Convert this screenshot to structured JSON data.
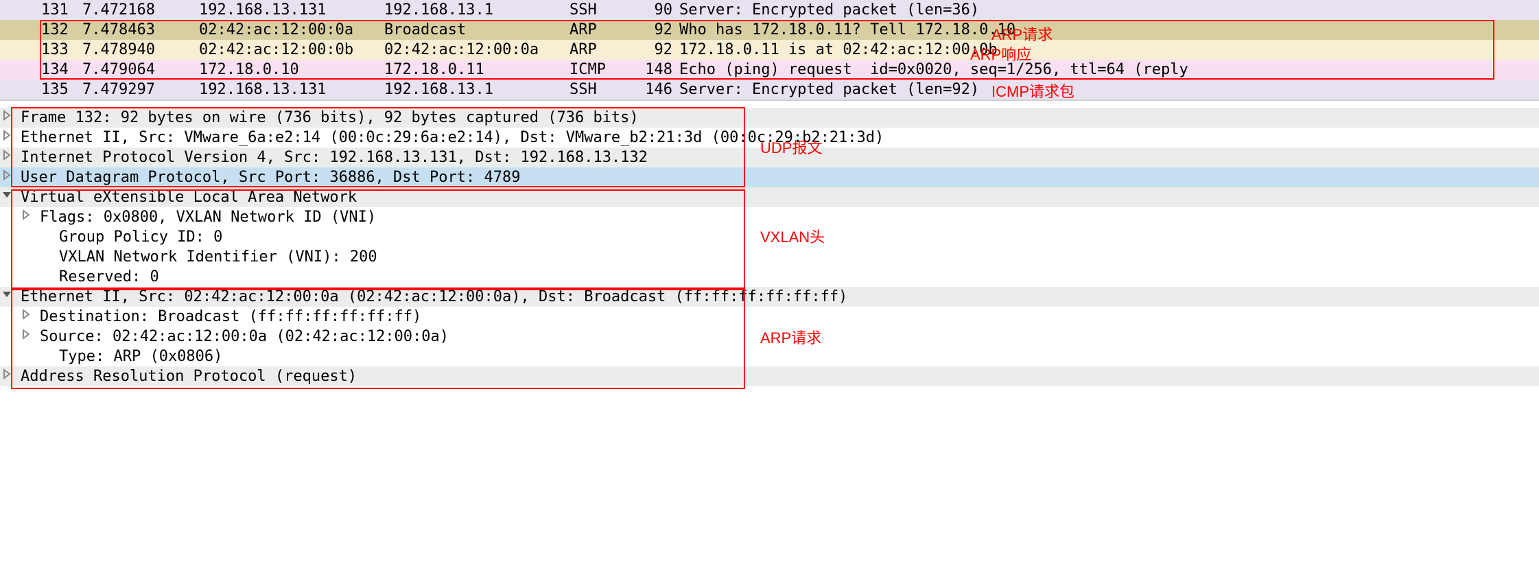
{
  "packets": [
    {
      "no": "131",
      "time": "7.472168",
      "src": "192.168.13.131",
      "dst": "192.168.13.1",
      "proto": "SSH",
      "len": "90",
      "info": "Server: Encrypted packet (len=36)",
      "bg": "bg-ssh"
    },
    {
      "no": "132",
      "time": "7.478463",
      "src": "02:42:ac:12:00:0a",
      "dst": "Broadcast",
      "proto": "ARP",
      "len": "92",
      "info": "Who has 172.18.0.11? Tell 172.18.0.10",
      "bg": "bg-arp1"
    },
    {
      "no": "133",
      "time": "7.478940",
      "src": "02:42:ac:12:00:0b",
      "dst": "02:42:ac:12:00:0a",
      "proto": "ARP",
      "len": "92",
      "info": "172.18.0.11 is at 02:42:ac:12:00:0b",
      "bg": "bg-arp2"
    },
    {
      "no": "134",
      "time": "7.479064",
      "src": "172.18.0.10",
      "dst": "172.18.0.11",
      "proto": "ICMP",
      "len": "148",
      "info": "Echo (ping) request  id=0x0020, seq=1/256, ttl=64 (reply ",
      "bg": "bg-icmp"
    },
    {
      "no": "135",
      "time": "7.479297",
      "src": "192.168.13.131",
      "dst": "192.168.13.1",
      "proto": "SSH",
      "len": "146",
      "info": "Server: Encrypted packet (len=92)",
      "bg": "bg-ssh"
    }
  ],
  "annotations": {
    "arp_req": "ARP请求",
    "arp_resp": "ARP响应",
    "icmp_req": "ICMP请求包",
    "udp_msg": "UDP报文",
    "vxlan_hdr": "VXLAN头",
    "arp_req2": "ARP请求"
  },
  "details": [
    {
      "indent": 0,
      "toggle": "right",
      "bg": "bg-grey",
      "text": "Frame 132: 92 bytes on wire (736 bits), 92 bytes captured (736 bits)"
    },
    {
      "indent": 0,
      "toggle": "right",
      "bg": "",
      "text": "Ethernet II, Src: VMware_6a:e2:14 (00:0c:29:6a:e2:14), Dst: VMware_b2:21:3d (00:0c:29:b2:21:3d)"
    },
    {
      "indent": 0,
      "toggle": "right",
      "bg": "bg-grey",
      "text": "Internet Protocol Version 4, Src: 192.168.13.131, Dst: 192.168.13.132"
    },
    {
      "indent": 0,
      "toggle": "right",
      "bg": "bg-blue",
      "text": "User Datagram Protocol, Src Port: 36886, Dst Port: 4789"
    },
    {
      "indent": 0,
      "toggle": "down",
      "bg": "bg-grey",
      "text": "Virtual eXtensible Local Area Network"
    },
    {
      "indent": 1,
      "toggle": "right",
      "bg": "",
      "text": "Flags: 0x0800, VXLAN Network ID (VNI)"
    },
    {
      "indent": 2,
      "toggle": "none",
      "bg": "",
      "text": "Group Policy ID: 0"
    },
    {
      "indent": 2,
      "toggle": "none",
      "bg": "",
      "text": "VXLAN Network Identifier (VNI): 200"
    },
    {
      "indent": 2,
      "toggle": "none",
      "bg": "",
      "text": "Reserved: 0"
    },
    {
      "indent": 0,
      "toggle": "down",
      "bg": "bg-grey",
      "text": "Ethernet II, Src: 02:42:ac:12:00:0a (02:42:ac:12:00:0a), Dst: Broadcast (ff:ff:ff:ff:ff:ff)"
    },
    {
      "indent": 1,
      "toggle": "right",
      "bg": "",
      "text": "Destination: Broadcast (ff:ff:ff:ff:ff:ff)"
    },
    {
      "indent": 1,
      "toggle": "right",
      "bg": "",
      "text": "Source: 02:42:ac:12:00:0a (02:42:ac:12:00:0a)"
    },
    {
      "indent": 2,
      "toggle": "none",
      "bg": "",
      "text": "Type: ARP (0x0806)"
    },
    {
      "indent": 0,
      "toggle": "right",
      "bg": "bg-grey",
      "text": "Address Resolution Protocol (request)"
    }
  ]
}
